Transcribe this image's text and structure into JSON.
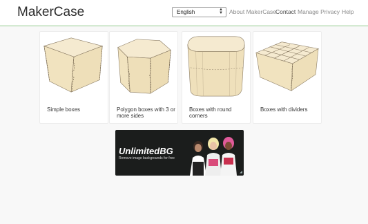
{
  "navbar": {
    "brand": "MakerCase",
    "language_selected": "English",
    "links": [
      {
        "label": "About MakerCase"
      },
      {
        "label": "Contact"
      },
      {
        "label": "Manage Privacy"
      },
      {
        "label": "Help"
      }
    ]
  },
  "cards": [
    {
      "label": "Simple boxes"
    },
    {
      "label": "Polygon boxes with 3 or more sides"
    },
    {
      "label": "Boxes with round corners"
    },
    {
      "label": "Boxes with dividers"
    }
  ],
  "ad": {
    "title": "UnlimitedBG",
    "tagline": "Remove image backgrounds for free"
  },
  "colors": {
    "wood": "#f3e6c3",
    "wood_edge": "#8a7b63",
    "nav_border": "#8fc98a",
    "ad_bg": "#1b1d1c"
  }
}
